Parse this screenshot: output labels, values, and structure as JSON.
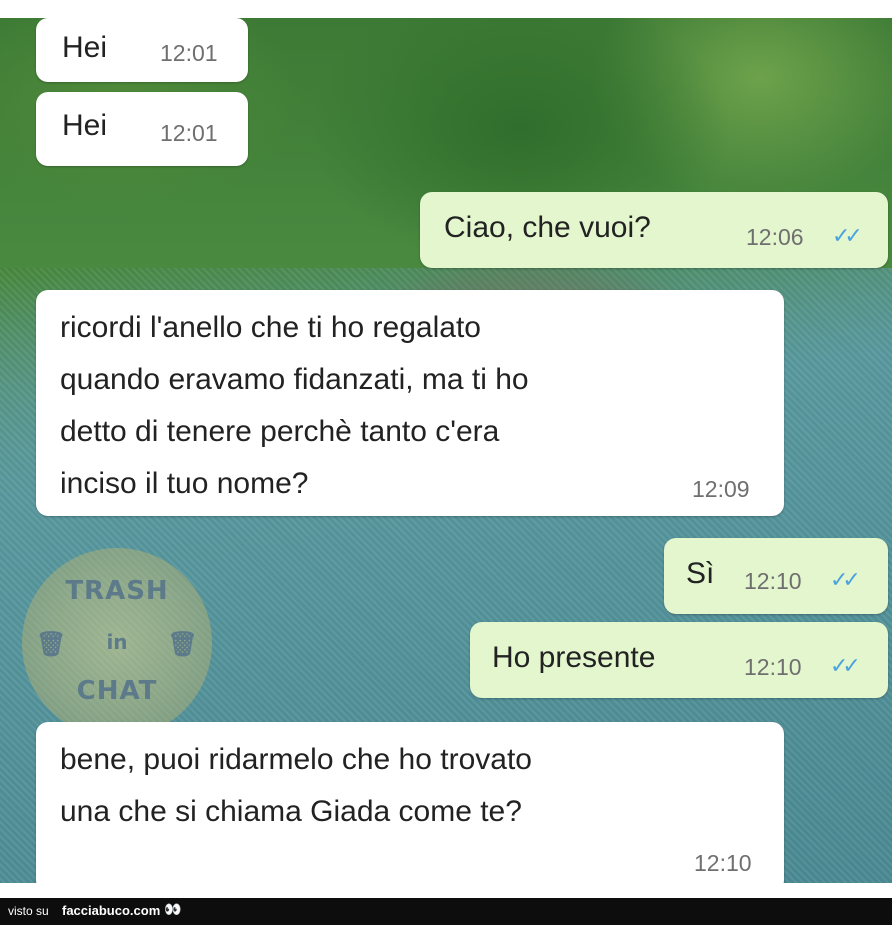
{
  "messages": [
    {
      "direction": "incoming",
      "text": "Hei",
      "time": "12:01"
    },
    {
      "direction": "incoming",
      "text": "Hei",
      "time": "12:01"
    },
    {
      "direction": "outgoing",
      "text": "Ciao, che vuoi?",
      "time": "12:06",
      "status": "read"
    },
    {
      "direction": "incoming",
      "text": "ricordi l'anello che ti ho regalato\nquando eravamo fidanzati, ma ti ho\ndetto di tenere perchè tanto c'era\ninciso il tuo nome?",
      "time": "12:09"
    },
    {
      "direction": "outgoing",
      "text": "Sì",
      "time": "12:10",
      "status": "read"
    },
    {
      "direction": "outgoing",
      "text": "Ho presente",
      "time": "12:10",
      "status": "read"
    },
    {
      "direction": "incoming",
      "text": "bene, puoi ridarmelo che ho trovato\nuna che si chiama Giada come te?",
      "time": "12:10"
    }
  ],
  "watermark": {
    "line1": "TRASH",
    "line2": "in",
    "line3": "CHAT"
  },
  "footer": {
    "prefix": "visto su",
    "site": "facciabuco.com",
    "logo_icon": "eyes-icon"
  },
  "colors": {
    "incoming_bubble": "#ffffff",
    "outgoing_bubble": "#e3f6cd",
    "read_ticks": "#4aa3df"
  }
}
